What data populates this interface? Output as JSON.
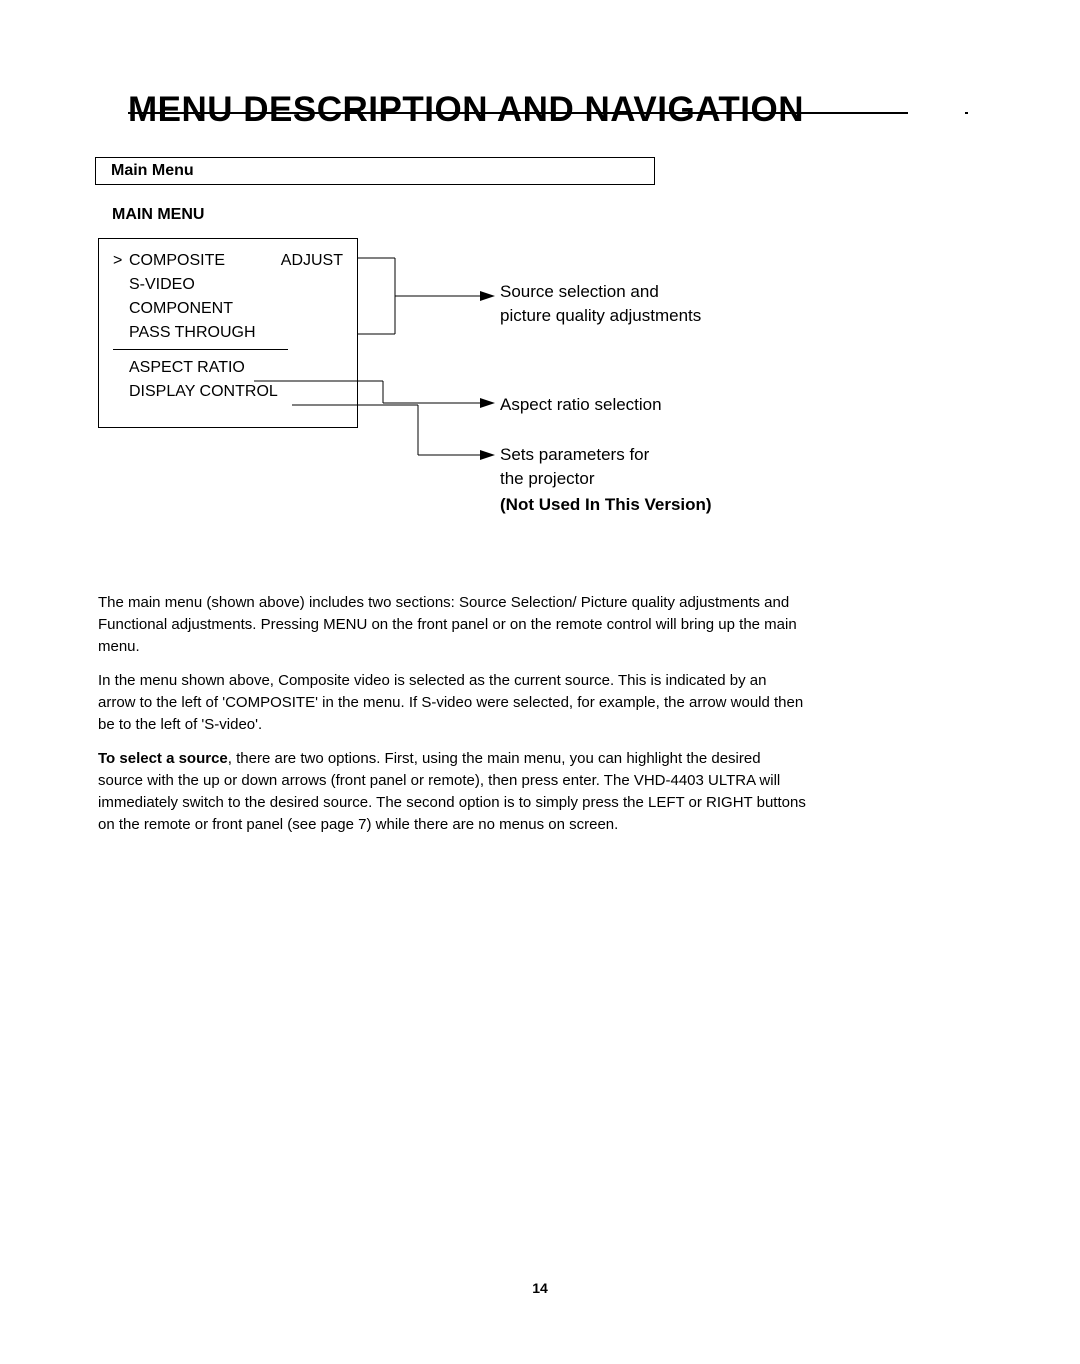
{
  "page_title": "MENU DESCRIPTION AND NAVIGATION",
  "section_header": "Main Menu",
  "main_menu_label": "MAIN MENU",
  "menu": {
    "selected_marker": ">",
    "items": [
      {
        "label": "COMPOSITE",
        "right": "ADJUST"
      },
      {
        "label": "S-VIDEO",
        "right": ""
      },
      {
        "label": "COMPONENT",
        "right": ""
      },
      {
        "label": "PASS THROUGH",
        "right": ""
      }
    ],
    "sub_items": [
      {
        "label": "ASPECT RATIO"
      },
      {
        "label": "DISPLAY CONTROL"
      }
    ]
  },
  "annotations": {
    "a1_line1": "Source selection and",
    "a1_line2": "picture quality adjustments",
    "a2": "Aspect ratio selection",
    "a3_line1": "Sets parameters for",
    "a3_line2": "the projector",
    "a3_note": "(Not Used In This Version)"
  },
  "body": {
    "p1": "The main menu (shown above) includes two sections: Source Selection/ Picture quality adjustments and Functional adjustments. Pressing MENU on the front panel or on the remote control will bring up the main menu.",
    "p2": "In the menu shown above, Composite video is selected as the current source. This is indicated by an arrow to the left of 'COMPOSITE' in the menu. If S-video were selected, for example, the arrow would then be to the left of 'S-video'.",
    "p3_strong": "To select a source",
    "p3_rest": ", there are two options. First, using the main menu, you can highlight the desired source with the up or down arrows (front panel or remote), then press enter. The VHD-4403 ULTRA will immediately switch to the desired source. The second option is to simply press the LEFT or RIGHT buttons on the remote or front panel (see page 7) while there are no menus on screen."
  },
  "page_number": "14"
}
